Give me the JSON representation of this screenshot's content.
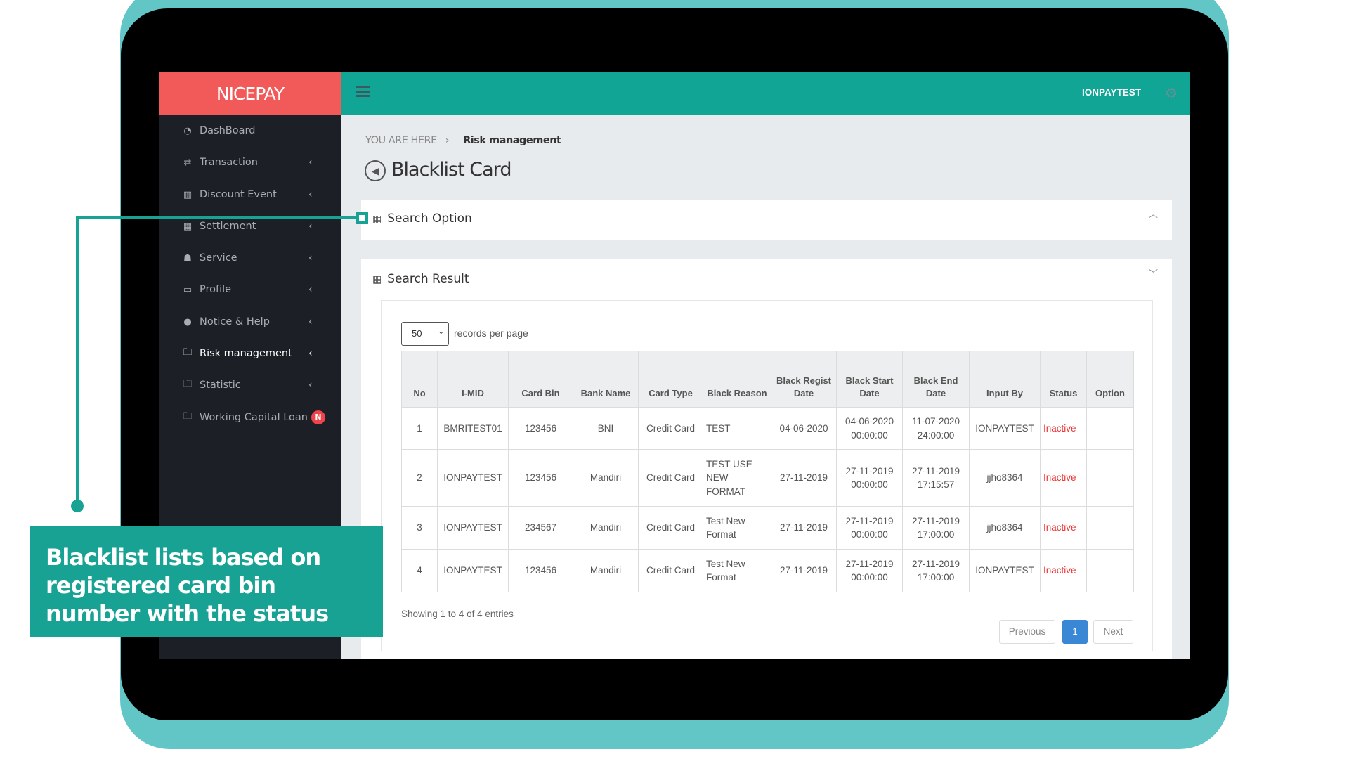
{
  "app": {
    "logo": "NICEPAY",
    "user": "IONPAYTEST"
  },
  "colors": {
    "brand": "#f15a59",
    "topbar": "#10a595",
    "sidebar": "#1c1f25",
    "accent": "#17a293",
    "inactive": "#e33333",
    "page_active": "#3a87d6"
  },
  "sidebar": {
    "items": [
      {
        "label": "DashBoard",
        "icon": "dashboard-icon",
        "glyph": "◔",
        "chevron": false
      },
      {
        "label": "Transaction",
        "icon": "exchange-icon",
        "glyph": "⇄",
        "chevron": true
      },
      {
        "label": "Discount Event",
        "icon": "bar-chart-icon",
        "glyph": "▥",
        "chevron": true
      },
      {
        "label": "Settlement",
        "icon": "calendar-icon",
        "glyph": "▦",
        "chevron": true
      },
      {
        "label": "Service",
        "icon": "users-icon",
        "glyph": "☗",
        "chevron": true
      },
      {
        "label": "Profile",
        "icon": "monitor-icon",
        "glyph": "▭",
        "chevron": true
      },
      {
        "label": "Notice & Help",
        "icon": "comment-icon",
        "glyph": "●",
        "chevron": true
      },
      {
        "label": "Risk management",
        "icon": "folder-icon",
        "glyph": "🗀",
        "chevron": true,
        "active": true
      },
      {
        "label": "Statistic",
        "icon": "folder-icon",
        "glyph": "🗀",
        "chevron": true
      },
      {
        "label": "Working Capital Loan",
        "icon": "folder-icon",
        "glyph": "🗀",
        "chevron": false,
        "badge": "N"
      }
    ]
  },
  "breadcrumb": {
    "prefix": "YOU ARE HERE",
    "separator": "›",
    "current": "Risk management"
  },
  "page": {
    "title": "Blacklist Card"
  },
  "search_option": {
    "title": "Search Option"
  },
  "search_result": {
    "title": "Search Result",
    "page_size": "50",
    "records_label": "records per page",
    "columns": [
      "No",
      "I-MID",
      "Card Bin",
      "Bank Name",
      "Card Type",
      "Black Reason",
      "Black Regist Date",
      "Black Start Date",
      "Black End Date",
      "Input By",
      "Status",
      "Option"
    ],
    "rows": [
      [
        "1",
        "BMRITEST01",
        "123456",
        "BNI",
        "Credit Card",
        "TEST",
        "04-06-2020",
        "04-06-2020 00:00:00",
        "11-07-2020 24:00:00",
        "IONPAYTEST",
        "Inactive",
        ""
      ],
      [
        "2",
        "IONPAYTEST",
        "123456",
        "Mandiri",
        "Credit Card",
        "TEST USE NEW FORMAT",
        "27-11-2019",
        "27-11-2019 00:00:00",
        "27-11-2019 17:15:57",
        "jjho8364",
        "Inactive",
        ""
      ],
      [
        "3",
        "IONPAYTEST",
        "234567",
        "Mandiri",
        "Credit Card",
        "Test New Format",
        "27-11-2019",
        "27-11-2019 00:00:00",
        "27-11-2019 17:00:00",
        "jjho8364",
        "Inactive",
        ""
      ],
      [
        "4",
        "IONPAYTEST",
        "123456",
        "Mandiri",
        "Credit Card",
        "Test New Format",
        "27-11-2019",
        "27-11-2019 00:00:00",
        "27-11-2019 17:00:00",
        "IONPAYTEST",
        "Inactive",
        ""
      ]
    ],
    "showing": "Showing 1 to 4 of 4 entries",
    "pagination": {
      "previous": "Previous",
      "current": "1",
      "next": "Next"
    }
  },
  "callout": {
    "text": "Blacklist lists based on registered card bin number with the status"
  }
}
